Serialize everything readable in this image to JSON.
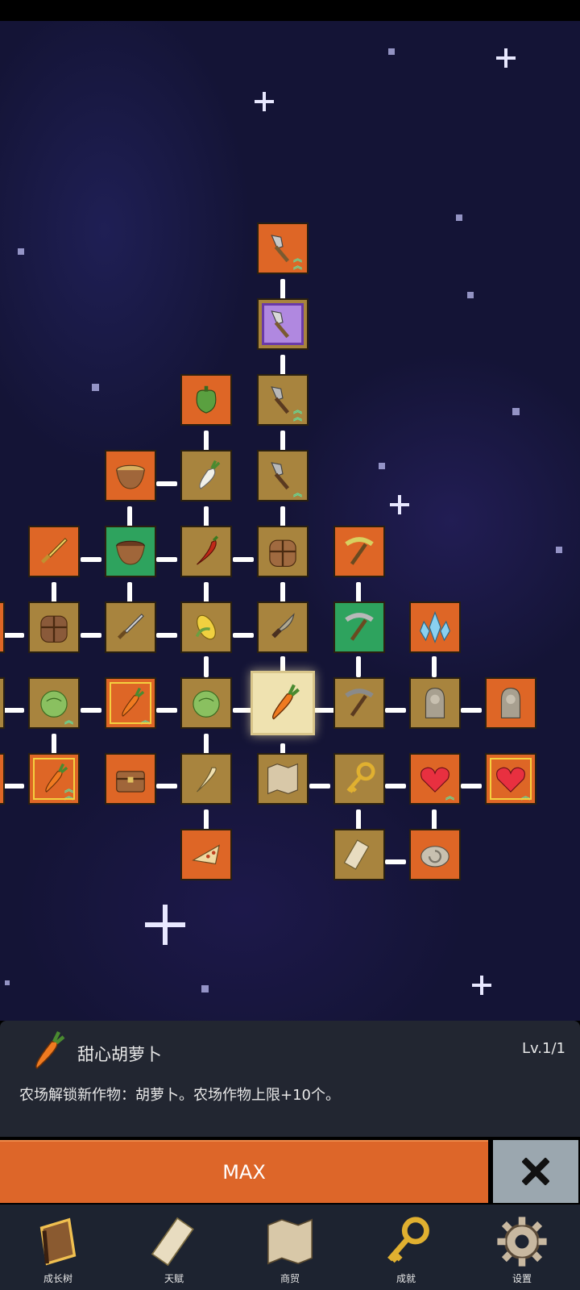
{
  "tree": {
    "selected": "node-carrot-center"
  },
  "info_panel": {
    "skill_name": "甜心胡萝卜",
    "level": "Lv.1/1",
    "description": "农场解锁新作物：胡萝卜。农场作物上限+10个。",
    "icon": "carrot-icon"
  },
  "actions": {
    "max_label": "MAX",
    "close_icon": "close-x-icon"
  },
  "bottom_nav": {
    "items": [
      {
        "label": "成长树",
        "icon": "book-icon"
      },
      {
        "label": "天赋",
        "icon": "scroll-icon"
      },
      {
        "label": "商贸",
        "icon": "map-icon"
      },
      {
        "label": "成就",
        "icon": "key-icon"
      },
      {
        "label": "设置",
        "icon": "gear-icon"
      }
    ]
  },
  "colors": {
    "accent_orange": "#dd6629",
    "node_tan": "#a8843e",
    "node_green": "#2ea35e",
    "panel_bg": "#222631",
    "sky": "#141436"
  }
}
